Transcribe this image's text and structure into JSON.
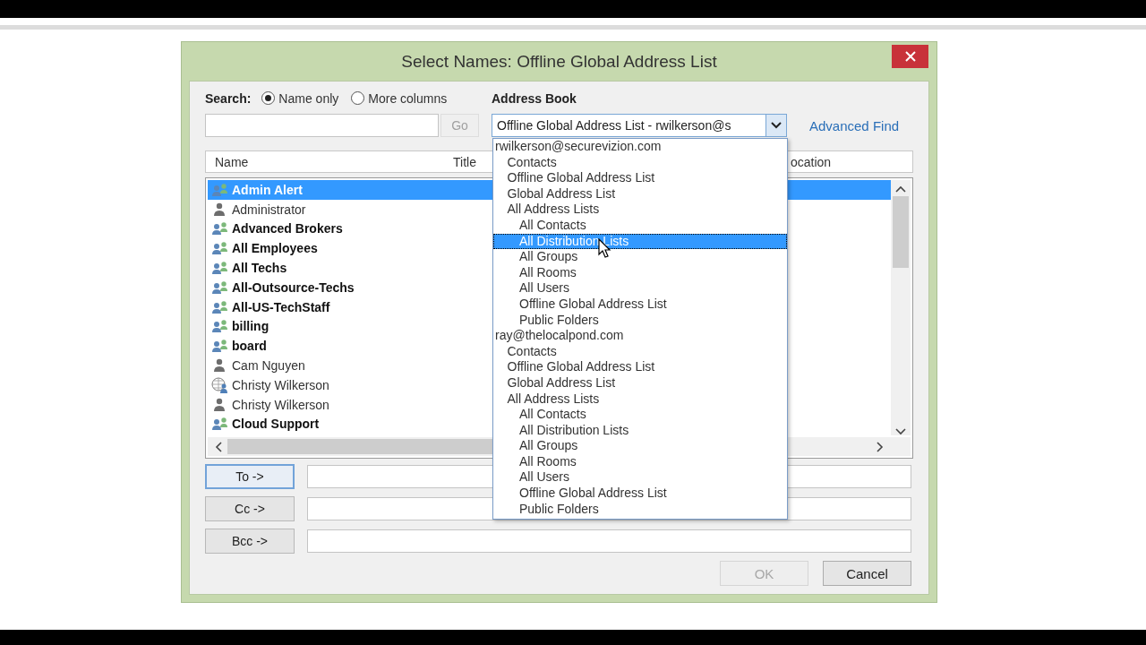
{
  "window": {
    "title": "Select Names: Offline Global Address List"
  },
  "search": {
    "label": "Search:",
    "options": [
      {
        "label": "Name only",
        "selected": true
      },
      {
        "label": "More columns",
        "selected": false
      }
    ],
    "go_button": {
      "label": "Go",
      "disabled": true
    }
  },
  "address_book": {
    "label": "Address Book",
    "value": "Offline Global Address List - rwilkerson@s",
    "dropdown": [
      {
        "label": "rwilkerson@securevizion.com",
        "selected": false,
        "children": [
          {
            "label": "Contacts",
            "selected": false
          },
          {
            "label": "Offline Global Address List",
            "selected": false
          },
          {
            "label": "Global Address List",
            "selected": false
          },
          {
            "label": "All Address Lists",
            "selected": false,
            "children": [
              {
                "label": "All Contacts",
                "selected": false
              },
              {
                "label": "All Distribution Lists",
                "selected": true
              },
              {
                "label": "All Groups",
                "selected": false
              },
              {
                "label": "All Rooms",
                "selected": false
              },
              {
                "label": "All Users",
                "selected": false
              },
              {
                "label": "Offline Global Address List",
                "selected": false
              },
              {
                "label": "Public Folders",
                "selected": false
              }
            ]
          }
        ]
      },
      {
        "label": "ray@thelocalpond.com",
        "selected": false,
        "children": [
          {
            "label": "Contacts",
            "selected": false
          },
          {
            "label": "Offline Global Address List",
            "selected": false
          },
          {
            "label": "Global Address List",
            "selected": false
          },
          {
            "label": "All Address Lists",
            "selected": false,
            "children": [
              {
                "label": "All Contacts",
                "selected": false
              },
              {
                "label": "All Distribution Lists",
                "selected": false
              },
              {
                "label": "All Groups",
                "selected": false
              },
              {
                "label": "All Rooms",
                "selected": false
              },
              {
                "label": "All Users",
                "selected": false
              },
              {
                "label": "Offline Global Address List",
                "selected": false
              },
              {
                "label": "Public Folders",
                "selected": false
              }
            ]
          }
        ]
      }
    ]
  },
  "advanced_find": "Advanced Find",
  "table": {
    "columns": [
      "Name",
      "Title",
      "ocation"
    ],
    "rows": [
      {
        "name": "Admin Alert",
        "kind": "group",
        "selected": true
      },
      {
        "name": "Administrator",
        "kind": "user",
        "selected": false
      },
      {
        "name": "Advanced Brokers",
        "kind": "group",
        "selected": false
      },
      {
        "name": "All Employees",
        "kind": "group",
        "selected": false
      },
      {
        "name": "All Techs",
        "kind": "group",
        "selected": false
      },
      {
        "name": "All-Outsource-Techs",
        "kind": "group",
        "selected": false
      },
      {
        "name": "All-US-TechStaff",
        "kind": "group",
        "selected": false
      },
      {
        "name": "billing",
        "kind": "group",
        "selected": false
      },
      {
        "name": "board",
        "kind": "group",
        "selected": false
      },
      {
        "name": "Cam Nguyen",
        "kind": "user",
        "selected": false
      },
      {
        "name": "Christy Wilkerson",
        "kind": "external",
        "selected": false
      },
      {
        "name": "Christy Wilkerson",
        "kind": "user",
        "selected": false
      },
      {
        "name": "Cloud Support",
        "kind": "group",
        "selected": false
      }
    ]
  },
  "recipients": [
    {
      "label": "To ->",
      "focused": true
    },
    {
      "label": "Cc ->",
      "focused": false
    },
    {
      "label": "Bcc ->",
      "focused": false
    }
  ],
  "buttons": [
    {
      "label": "OK",
      "disabled": true
    },
    {
      "label": "Cancel",
      "disabled": false
    }
  ]
}
